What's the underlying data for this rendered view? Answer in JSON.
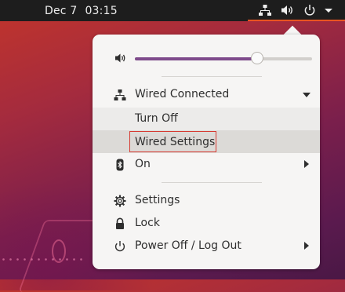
{
  "topbar": {
    "date": "Dec 7",
    "time": "03:15",
    "icons": [
      "network-wired-icon",
      "volume-icon",
      "power-icon",
      "menu-arrow-icon"
    ],
    "accent": "#e95420"
  },
  "menu": {
    "volume": {
      "icon": "speaker-icon",
      "level": 0.69
    },
    "network": {
      "label": "Wired Connected",
      "icon": "network-wired-icon",
      "items": [
        {
          "label": "Turn Off"
        },
        {
          "label": "Wired Settings"
        }
      ]
    },
    "bluetooth": {
      "label": "On",
      "icon": "bluetooth-icon"
    },
    "settings": {
      "label": "Settings",
      "icon": "gear-icon"
    },
    "lock": {
      "label": "Lock",
      "icon": "lock-icon"
    },
    "power": {
      "label": "Power Off / Log Out",
      "icon": "power-icon"
    }
  },
  "colors": {
    "slider_fill": "#7e4a8b",
    "highlight_border": "#d63b32",
    "menu_bg": "#f6f5f4"
  }
}
